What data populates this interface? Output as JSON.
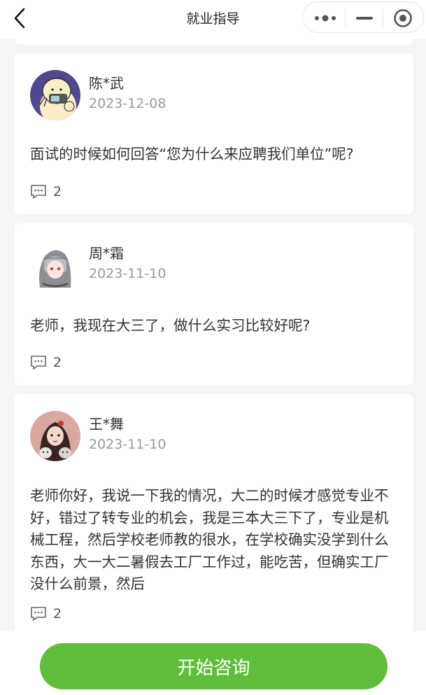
{
  "header": {
    "title": "就业指导",
    "back_icon": "chevron-left-icon",
    "capsule": {
      "more_icon": "more-dots-icon",
      "minimize_icon": "minimize-icon",
      "close_icon": "target-close-icon"
    }
  },
  "posts": [
    {
      "name": "陈*武",
      "date": "2023-12-08",
      "content": "面试的时候如何回答“您为什么来应聘我们单位”呢?",
      "comment_count": "2",
      "avatar_icon": "cartoon-avatar"
    },
    {
      "name": "周*霜",
      "date": "2023-11-10",
      "content": "老师，我现在大三了，做什么实习比较好呢?",
      "comment_count": "2",
      "avatar_icon": "anime-avatar"
    },
    {
      "name": "王*舞",
      "date": "2023-11-10",
      "content": "老师你好，我说一下我的情况，大二的时候才感觉专业不好，错过了转专业的机会，我是三本大三下了，专业是机械工程，然后学校老师教的很水，在学校确实没学到什么东西，大一大二暑假去工厂工作过，能吃苦，但确实工厂没什么前景，然后",
      "comment_count": "2",
      "avatar_icon": "girl-with-cats-avatar"
    }
  ],
  "comment_icon": "comment-icon",
  "footer": {
    "consult_label": "开始咨询"
  },
  "colors": {
    "accent": "#5fbf3c",
    "background": "#f5f5f5",
    "muted_text": "#999999"
  }
}
